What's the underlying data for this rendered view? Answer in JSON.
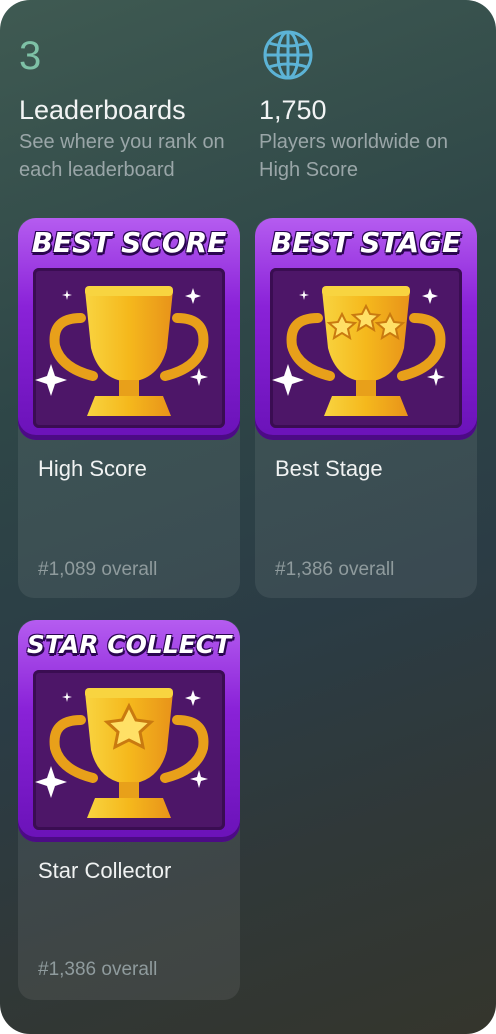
{
  "stats": [
    {
      "value": "3",
      "label": "Leaderboards",
      "description": "See where you rank on each leaderboard",
      "icon": "number-display"
    },
    {
      "value": "1,750",
      "description": "Players worldwide on High Score",
      "icon": "globe-icon"
    }
  ],
  "leaderboards": [
    {
      "banner": "BEST SCORE",
      "name": "High Score",
      "rank": "#1,089 overall",
      "emblem": "trophy-icon"
    },
    {
      "banner": "BEST STAGE",
      "name": "Best Stage",
      "rank": "#1,386 overall",
      "emblem": "trophy-three-stars-icon"
    },
    {
      "banner": "STAR COLLECT",
      "name": "Star Collector",
      "rank": "#1,386 overall",
      "emblem": "trophy-star-icon"
    }
  ],
  "colors": {
    "accent": "#7ec1a6",
    "badge_purple": "#8a22d8",
    "trophy_gold": "#f5b81c"
  }
}
